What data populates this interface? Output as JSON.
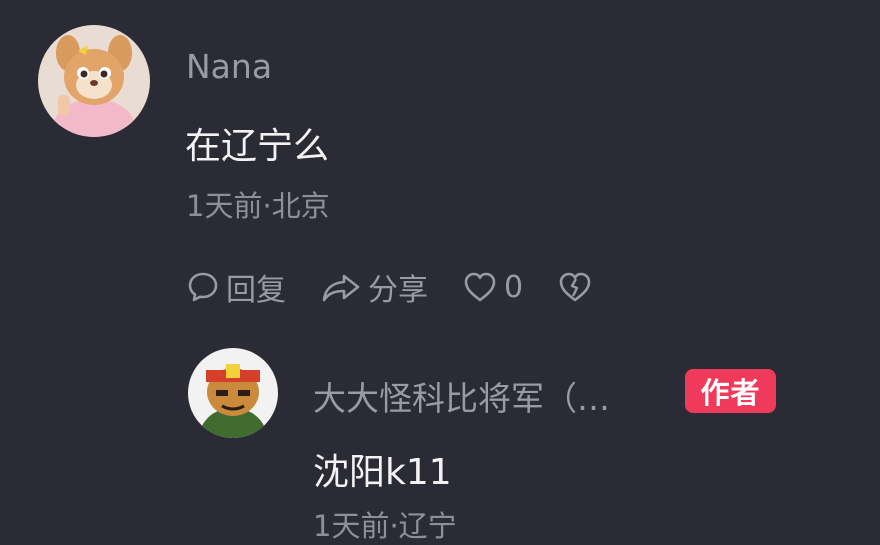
{
  "comment": {
    "username": "Nana",
    "text": "在辽宁么",
    "meta": "1天前·北京",
    "actions": {
      "reply_label": "回复",
      "share_label": "分享",
      "like_count": "0"
    }
  },
  "reply": {
    "username": "大大怪科比将军（…",
    "author_badge": "作者",
    "text": "沈阳k11",
    "meta": "1天前·辽宁"
  },
  "colors": {
    "background": "#2b2b35",
    "badge": "#f03a5c"
  },
  "icons": {
    "reply": "comment-bubble-icon",
    "share": "share-arrow-icon",
    "like": "heart-icon",
    "dislike": "broken-heart-icon"
  }
}
